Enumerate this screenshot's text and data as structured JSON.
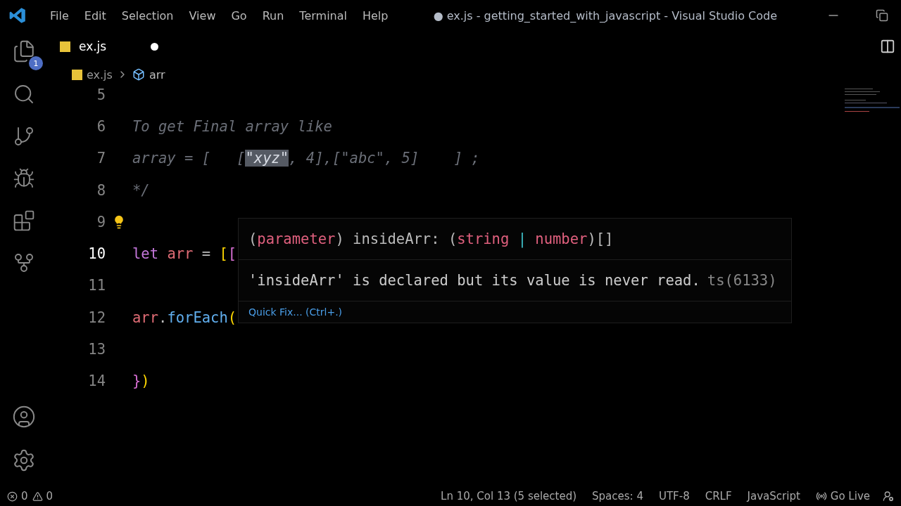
{
  "window": {
    "title": "● ex.js - getting_started_with_javascript - Visual Studio Code"
  },
  "menu": [
    "File",
    "Edit",
    "Selection",
    "View",
    "Go",
    "Run",
    "Terminal",
    "Help"
  ],
  "activity_bar": {
    "explorer_badge": "1"
  },
  "tabs": [
    {
      "label": "ex.js",
      "selected": true,
      "modified": true
    }
  ],
  "breadcrumb": [
    "ex.js",
    "arr"
  ],
  "lines": [
    {
      "number": "5",
      "current": false
    },
    {
      "number": "6",
      "current": false,
      "tokens": [
        {
          "text": "To get Final array like",
          "kind": "comment"
        }
      ]
    },
    {
      "number": "7",
      "current": false,
      "tokens": [
        {
          "text": "array = [   [",
          "kind": "comment"
        },
        {
          "text": "\"xyz\"",
          "kind": "comment",
          "highlighted": true
        },
        {
          "text": ", 4],[\"abc\", 5]    ] ;",
          "kind": "comment"
        }
      ]
    },
    {
      "number": "8",
      "current": false,
      "tokens": [
        {
          "text": "*/",
          "kind": "comment"
        }
      ]
    },
    {
      "number": "9",
      "current": false,
      "lightbulb": true
    },
    {
      "number": "10",
      "current": true,
      "tokens": [
        {
          "text": "let ",
          "kind": "keyword"
        },
        {
          "text": "arr",
          "kind": "variable"
        },
        {
          "text": " = ",
          "kind": "plain"
        },
        {
          "text": "[",
          "kind": "bracket1"
        },
        {
          "text": "[",
          "kind": "bracket2"
        }
      ]
    },
    {
      "number": "11",
      "current": false
    },
    {
      "number": "12",
      "current": false,
      "tokens": [
        {
          "text": "arr",
          "kind": "variable"
        },
        {
          "text": ".",
          "kind": "plain"
        },
        {
          "text": "forEach",
          "kind": "function"
        },
        {
          "text": "(",
          "kind": "bracket1"
        }
      ]
    },
    {
      "number": "13",
      "current": false
    },
    {
      "number": "14",
      "current": false,
      "tokens": [
        {
          "text": "}",
          "kind": "bracket2"
        },
        {
          "text": ")",
          "kind": "bracket1"
        }
      ]
    }
  ],
  "hover": {
    "signature": [
      {
        "text": "(",
        "kind": "plain"
      },
      {
        "text": "parameter",
        "kind": "type"
      },
      {
        "text": ") insideArr: (",
        "kind": "plain"
      },
      {
        "text": "string",
        "kind": "type"
      },
      {
        "text": " | ",
        "kind": "operator"
      },
      {
        "text": "number",
        "kind": "type"
      },
      {
        "text": ")[]",
        "kind": "plain"
      }
    ],
    "message": "'insideArr' is declared but its value is never read.",
    "code": "ts(6133)",
    "action": "Quick Fix... (Ctrl+.)"
  },
  "status_bar": {
    "errors": "0",
    "warnings": "0",
    "items": [
      "Ln 10, Col 13 (5 selected)",
      "Spaces: 4",
      "UTF-8",
      "CRLF",
      "JavaScript"
    ],
    "go_live": "Go Live"
  }
}
